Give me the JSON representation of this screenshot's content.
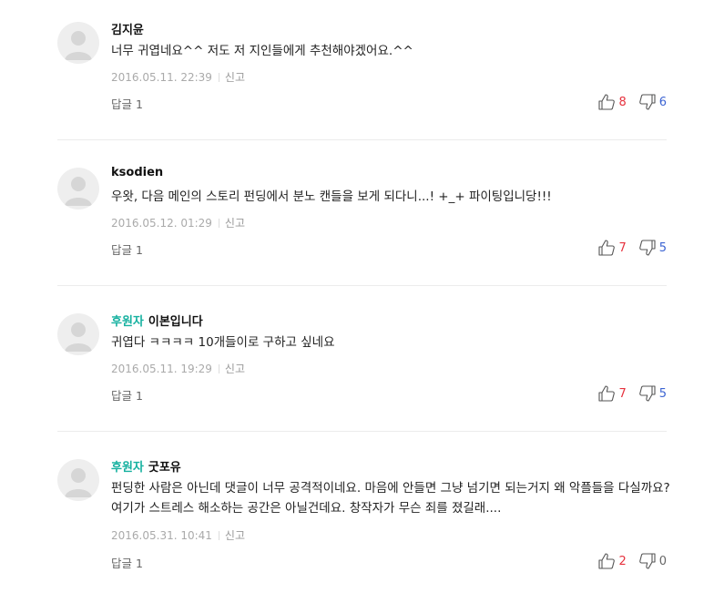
{
  "comments": [
    {
      "badge": "",
      "author": "김지윤",
      "text": "너무 귀엽네요^^ 저도 저 지인들에게 추천해야겠어요.^^",
      "date": "2016.05.11. 22:39",
      "report_label": "신고",
      "reply_label": "답글 1",
      "likes": "8",
      "dislikes": "6"
    },
    {
      "badge": "",
      "author": "ksodien",
      "text": "우왓, 다음 메인의 스토리 펀딩에서 분노 캔들을 보게 되다니...! +_+ 파이팅입니당!!!",
      "date": "2016.05.12. 01:29",
      "report_label": "신고",
      "reply_label": "답글 1",
      "likes": "7",
      "dislikes": "5"
    },
    {
      "badge": "후원자",
      "author": "이본입니다",
      "text": "귀엽다 ㅋㅋㅋㅋ 10개들이로 구하고 싶네요",
      "date": "2016.05.11. 19:29",
      "report_label": "신고",
      "reply_label": "답글 1",
      "likes": "7",
      "dislikes": "5"
    },
    {
      "badge": "후원자",
      "author": "굿포유",
      "text": "펀딩한 사람은 아닌데 댓글이 너무 공격적이네요. 마음에 안들면 그냥 넘기면 되는거지 왜 악플들을 다실까요? 여기가 스트레스 해소하는 공간은 아닐건데요.  창작자가 무슨 죄를 졌길래....",
      "date": "2016.05.31. 10:41",
      "report_label": "신고",
      "reply_label": "답글 1",
      "likes": "2",
      "dislikes": "0"
    }
  ],
  "icons": {
    "avatar": "default-avatar-icon",
    "like": "thumbs-up-icon",
    "dislike": "thumbs-down-icon"
  },
  "colors": {
    "badge": "#16b1a0",
    "like_count": "#e6323e",
    "dislike_count": "#3c64d2"
  }
}
